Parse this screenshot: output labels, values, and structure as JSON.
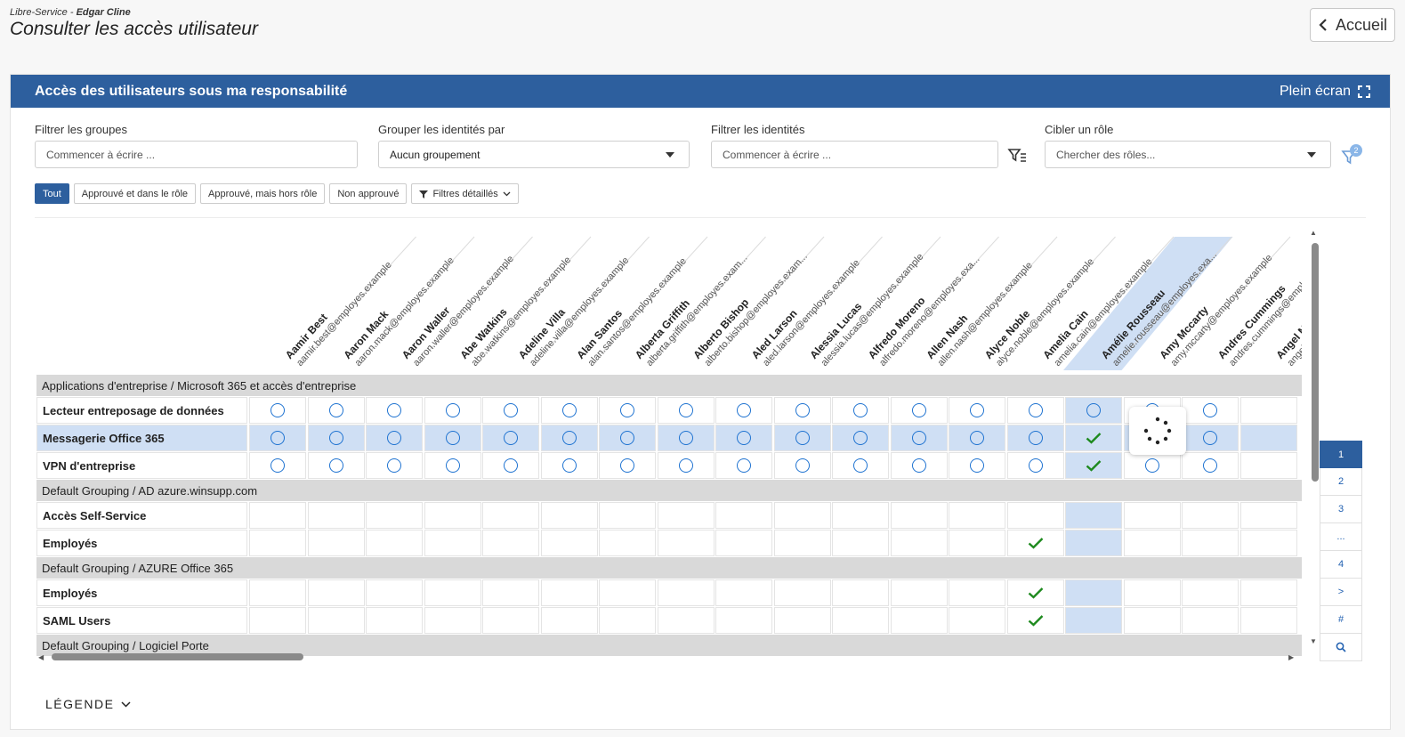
{
  "breadcrumb": {
    "prefix": "Libre-Service - ",
    "user": "Edgar Cline"
  },
  "page_title": "Consulter les accès utilisateur",
  "home_button": "Accueil",
  "panel": {
    "title": "Accès des utilisateurs sous ma responsabilité",
    "fullscreen": "Plein écran"
  },
  "filters": {
    "groups": {
      "label": "Filtrer les groupes",
      "placeholder": "Commencer à écrire ..."
    },
    "grouping": {
      "label": "Grouper les identités par",
      "value": "Aucun groupement"
    },
    "identities": {
      "label": "Filtrer les identités",
      "placeholder": "Commencer à écrire ..."
    },
    "role": {
      "label": "Cibler un rôle",
      "placeholder": "Chercher des rôles...",
      "badge": "2"
    }
  },
  "chips": [
    "Tout",
    "Approuvé et dans le rôle",
    "Approuvé, mais hors rôle",
    "Non approuvé",
    "Filtres détaillés"
  ],
  "columns": [
    {
      "name": "Aamir Best",
      "email": "aamir.best@employes.example"
    },
    {
      "name": "Aaron Mack",
      "email": "aaron.mack@employes.example"
    },
    {
      "name": "Aaron Waller",
      "email": "aaron.waller@employes.example"
    },
    {
      "name": "Abe Watkins",
      "email": "abe.watkins@employes.example"
    },
    {
      "name": "Adeline Villa",
      "email": "adeline.villa@employes.example"
    },
    {
      "name": "Alan Santos",
      "email": "alan.santos@employes.example"
    },
    {
      "name": "Alberta Griffith",
      "email": "alberta.griffith@employes.exam..."
    },
    {
      "name": "Alberto Bishop",
      "email": "alberto.bishop@employes.exam..."
    },
    {
      "name": "Aled Larson",
      "email": "aled.larson@employes.example"
    },
    {
      "name": "Alessia Lucas",
      "email": "alessia.lucas@employes.example"
    },
    {
      "name": "Alfredo Moreno",
      "email": "alfredo.moreno@employes.exa..."
    },
    {
      "name": "Allen Nash",
      "email": "allen.nash@employes.example"
    },
    {
      "name": "Alyce Noble",
      "email": "alyce.noble@employes.example"
    },
    {
      "name": "Amelia Cain",
      "email": "amelia.cain@employes.example"
    },
    {
      "name": "Amélie Rousseau",
      "email": "amelie.rousseau@employes.exa..."
    },
    {
      "name": "Amy Mccarty",
      "email": "amy.mccarty@employes.example"
    },
    {
      "name": "Andres Cummings",
      "email": "andres.cummings@employes.example"
    },
    {
      "name": "Angel Ma",
      "email": "angel.m"
    }
  ],
  "sections": [
    {
      "group": "Applications d'entreprise / Microsoft 365 et accès d'entreprise",
      "rows": [
        {
          "label": "Lecteur entreposage de données",
          "cells": "ccccccccccccccccc"
        },
        {
          "label": "Messagerie Office 365",
          "cells": "ccccccccccccccvcc"
        },
        {
          "label": "VPN d'entreprise",
          "cells": "ccccccccccccccvcc"
        }
      ]
    },
    {
      "group": "Default Grouping / AD azure.winsupp.com",
      "rows": [
        {
          "label": "Accès Self-Service",
          "cells": "................."
        },
        {
          "label": "Employés",
          "cells": ".............v..."
        }
      ]
    },
    {
      "group": "Default Grouping / AZURE Office 365",
      "rows": [
        {
          "label": "Employés",
          "cells": ".............v..."
        },
        {
          "label": "SAML Users",
          "cells": ".............v..."
        }
      ]
    },
    {
      "group": "Default Grouping / Logiciel Porte",
      "rows": []
    }
  ],
  "pager": [
    "1",
    "2",
    "3",
    "...",
    "4",
    ">",
    "#"
  ],
  "legend": "LÉGENDE",
  "colors": {
    "brand": "#2d5f9e",
    "highlight": "#cfdff4",
    "check": "#1e8a1e",
    "circle": "#1f73d1"
  }
}
